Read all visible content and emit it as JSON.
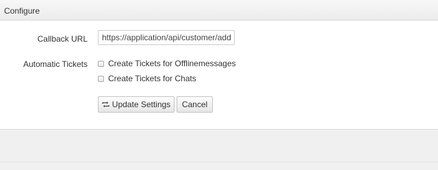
{
  "header": {
    "title": "Configure"
  },
  "form": {
    "callback_url": {
      "label": "Callback URL",
      "value": "https://application/api/customer/addo"
    },
    "automatic_tickets": {
      "label": "Automatic Tickets",
      "options": [
        {
          "label": "Create Tickets for Offlinemessages",
          "checked": false
        },
        {
          "label": "Create Tickets for Chats",
          "checked": false
        }
      ]
    }
  },
  "buttons": {
    "update": {
      "label": "Update Settings",
      "icon": "refresh-icon"
    },
    "cancel": {
      "label": "Cancel"
    }
  }
}
